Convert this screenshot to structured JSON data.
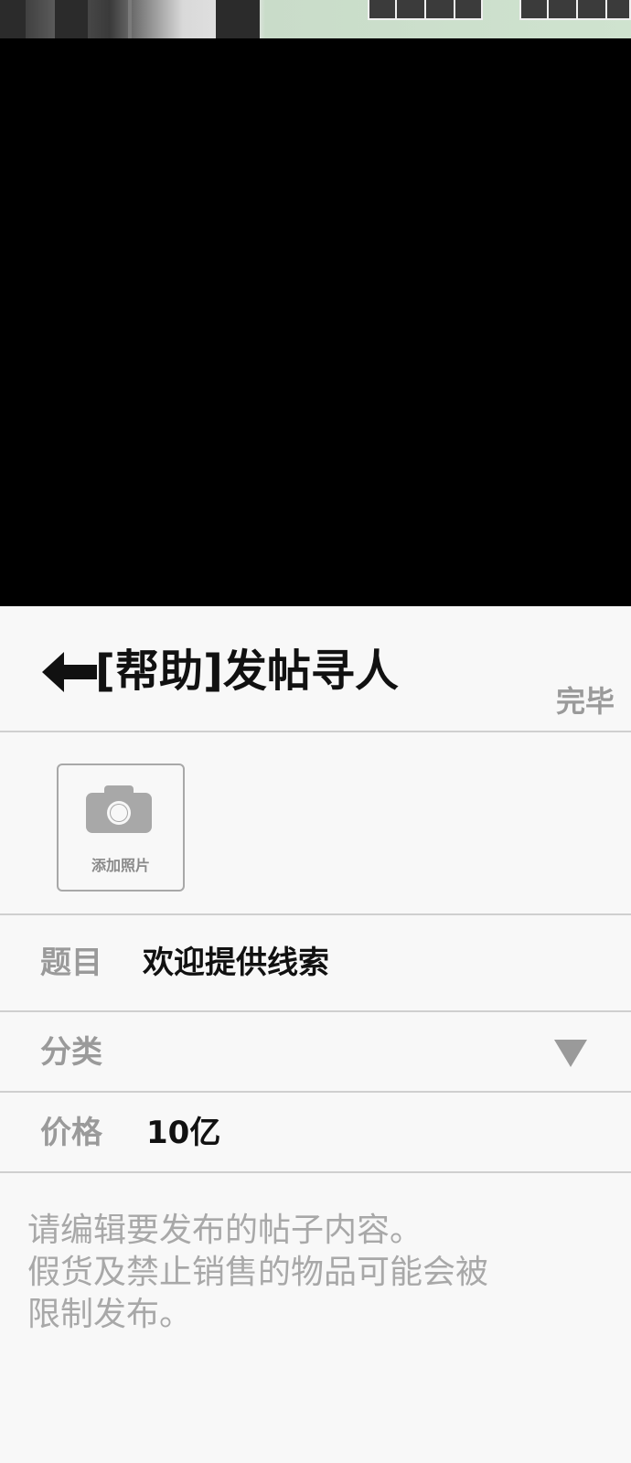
{
  "header": {
    "title": "[帮助]发帖寻人",
    "done_label": "完毕"
  },
  "photo": {
    "add_label": "添加照片"
  },
  "fields": {
    "title_label": "题目",
    "title_value": "欢迎提供线索",
    "category_label": "分类",
    "price_label": "价格",
    "price_value": "10亿"
  },
  "content": {
    "placeholder_lines": [
      "请编辑要发布的帖子内容。",
      "假货及禁止销售的物品可能会被",
      "限制发布。"
    ]
  },
  "icons": {
    "back": "arrow-left-icon",
    "camera": "camera-icon",
    "dropdown": "triangle-down-icon"
  },
  "colors": {
    "title_text": "#111111",
    "muted_text": "#9a9a9a",
    "divider": "#cfcfcf",
    "background": "#f8f8f8"
  }
}
